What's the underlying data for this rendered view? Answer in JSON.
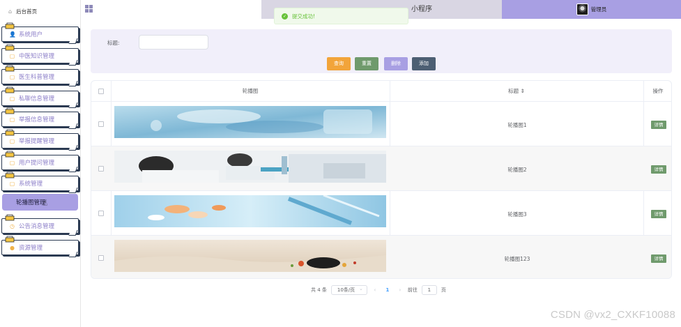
{
  "sidebar": {
    "home_label": "后台首页",
    "items": [
      {
        "label": "系统用户",
        "icon": "user-icon"
      },
      {
        "label": "中医知识管理",
        "icon": "document-icon"
      },
      {
        "label": "医生科普管理",
        "icon": "document-icon"
      },
      {
        "label": "私聊信息管理",
        "icon": "document-icon"
      },
      {
        "label": "举报信息管理",
        "icon": "document-icon"
      },
      {
        "label": "举报提醒管理",
        "icon": "document-icon"
      },
      {
        "label": "用户提问管理",
        "icon": "document-icon"
      },
      {
        "label": "系统管理",
        "icon": "document-icon"
      },
      {
        "label": "公告消息管理",
        "icon": "clock-icon"
      },
      {
        "label": "资源管理",
        "icon": "location-icon"
      }
    ],
    "active_sub_item": "轮播图管理"
  },
  "header": {
    "title_visible": "小程序",
    "user_label": "管理员"
  },
  "toast": {
    "message": "提交成功!",
    "color": "#67c23a"
  },
  "search": {
    "title_label": "标题:",
    "title_value": "",
    "buttons": {
      "query": "查询",
      "reset": "重置",
      "delete": "删除",
      "add": "添加"
    },
    "colors": {
      "query": "#f2a43a",
      "reset": "#6f9a6c",
      "delete": "#a89fe3",
      "add": "#4d5f73"
    }
  },
  "table": {
    "headers": {
      "image": "轮播图",
      "title": "标题 ⇕",
      "action": "操作"
    },
    "rows": [
      {
        "title": "轮播图1",
        "action": "详情"
      },
      {
        "title": "轮播图2",
        "action": "详情"
      },
      {
        "title": "轮播图3",
        "action": "详情"
      },
      {
        "title": "轮播图123",
        "action": "详情"
      }
    ]
  },
  "pagination": {
    "total": "共 4 条",
    "page_size": "10条/页",
    "current_page": "1",
    "goto_label": "前往",
    "goto_value": "1",
    "page_suffix": "页"
  },
  "watermark": "CSDN @vx2_CXKF10088",
  "accent_color": "#a89fe3"
}
